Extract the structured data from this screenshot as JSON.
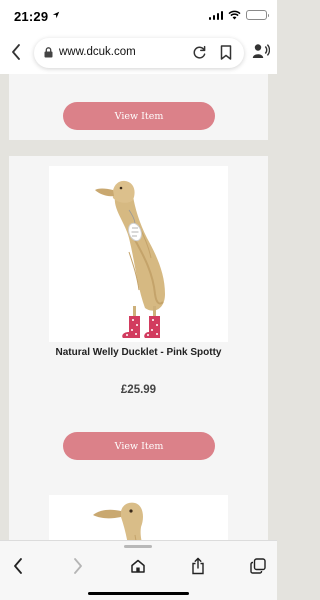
{
  "status": {
    "time": "21:29"
  },
  "browser": {
    "url": "www.dcuk.com"
  },
  "products": [
    {
      "button_label": "View Item"
    },
    {
      "name": "Natural Welly Ducklet - Pink Spotty",
      "price": "£25.99",
      "button_label": "View Item"
    }
  ],
  "colors": {
    "button": "#db8189",
    "page_background": "#e4e3de",
    "card_background": "#f5f5f5"
  },
  "icons": {
    "status": [
      "location-arrow-icon",
      "signal-icon",
      "wifi-icon",
      "battery-icon"
    ],
    "browser": [
      "back-chevron-icon",
      "lock-icon",
      "reload-icon",
      "bookmark-icon",
      "reader-icon"
    ],
    "toolbar": [
      "back-icon",
      "forward-icon",
      "home-icon",
      "share-icon",
      "tabs-icon"
    ]
  }
}
